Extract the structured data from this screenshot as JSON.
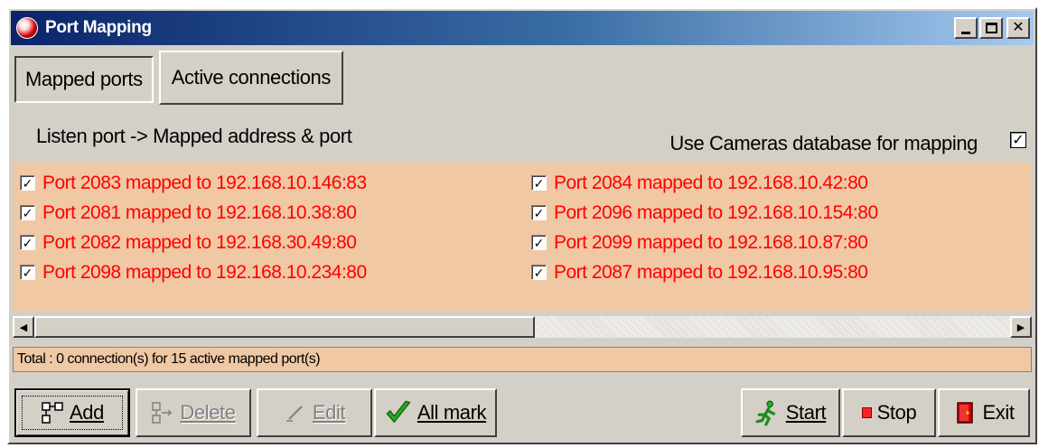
{
  "window": {
    "title": "Port Mapping"
  },
  "tabs": [
    {
      "label": "Mapped ports",
      "active": true
    },
    {
      "label": "Active connections",
      "active": false
    }
  ],
  "list_header": "Listen port -> Mapped address & port",
  "use_cameras": {
    "label": "Use Cameras database for mapping",
    "checked": true
  },
  "mappings_left": [
    {
      "text": "Port 2083 mapped to 192.168.10.146:83",
      "checked": true
    },
    {
      "text": "Port 2081 mapped to 192.168.10.38:80",
      "checked": true
    },
    {
      "text": "Port 2082 mapped to 192.168.30.49:80",
      "checked": true
    },
    {
      "text": "Port 2098 mapped to 192.168.10.234:80",
      "checked": true
    }
  ],
  "mappings_right": [
    {
      "text": "Port 2084 mapped to 192.168.10.42:80",
      "checked": true
    },
    {
      "text": "Port 2096 mapped to 192.168.10.154:80",
      "checked": true
    },
    {
      "text": "Port 2099 mapped to 192.168.10.87:80",
      "checked": true
    },
    {
      "text": "Port 2087 mapped to 192.168.10.95:80",
      "checked": true
    }
  ],
  "status": "Total : 0 connection(s) for 15 active mapped port(s)",
  "buttons": {
    "add": "Add",
    "delete": "Delete",
    "edit": "Edit",
    "all_mark": "All mark",
    "start": "Start",
    "stop": "Stop",
    "exit": "Exit"
  },
  "colors": {
    "title_gradient_start": "#0a246a",
    "mapping_text": "#ff0000",
    "list_background": "#f0c8a4",
    "window_face": "#d4d0c8"
  },
  "icons": {
    "app": "port-mapping-app-icon",
    "add": "add-network-icon",
    "delete": "delete-network-icon",
    "edit": "edit-pen-icon",
    "all_mark": "green-check-icon",
    "start": "running-man-icon",
    "stop": "red-square-icon",
    "exit": "door-exit-icon"
  }
}
